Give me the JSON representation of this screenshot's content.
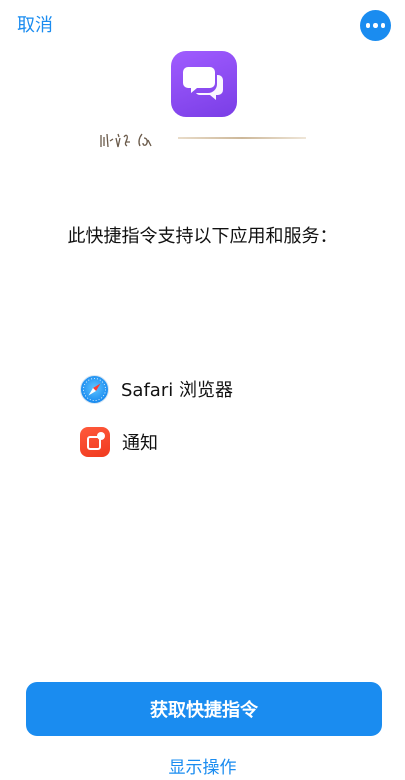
{
  "header": {
    "cancel_label": "取消",
    "more_icon": "ellipsis-icon"
  },
  "shortcut": {
    "icon": "speech-bubbles-icon",
    "name_signature": "handwritten-signature",
    "support_text": "此快捷指令支持以下应用和服务："
  },
  "services": [
    {
      "label": "Safari 浏览器",
      "icon": "safari-compass-icon"
    },
    {
      "label": "通知",
      "icon": "notification-icon"
    }
  ],
  "actions": {
    "get_shortcut_label": "获取快捷指令",
    "show_actions_label": "显示操作"
  },
  "colors": {
    "accent": "#1a8cf0",
    "app_icon": "#8a4cf2",
    "notify": "#f03a1e"
  }
}
